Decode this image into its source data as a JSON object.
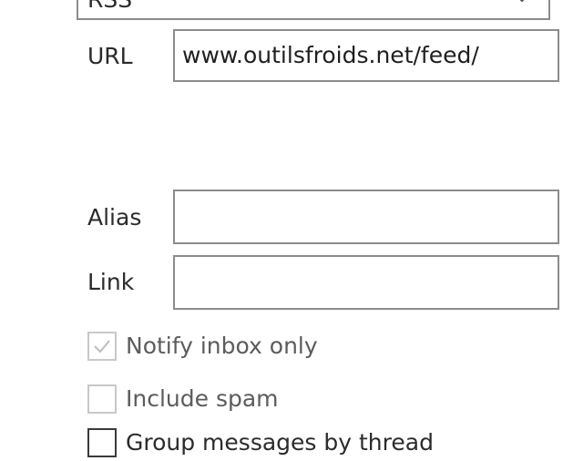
{
  "feed": {
    "type_value": "RSS",
    "url_label": "URL",
    "url_value": "www.outilsfroids.net/feed/"
  },
  "options": {
    "alias_label": "Alias",
    "alias_value": "",
    "link_label": "Link",
    "link_value": "",
    "notify_inbox_only": {
      "label": "Notify inbox only",
      "checked": true,
      "enabled": false
    },
    "include_spam": {
      "label": "Include spam",
      "checked": false,
      "enabled": false
    },
    "cut_off_checkbox_label": "Group messages by thread"
  },
  "colors": {
    "border": "#8c8c8c",
    "disabled_text": "#5c5c5c",
    "text": "#2b2b2b"
  }
}
